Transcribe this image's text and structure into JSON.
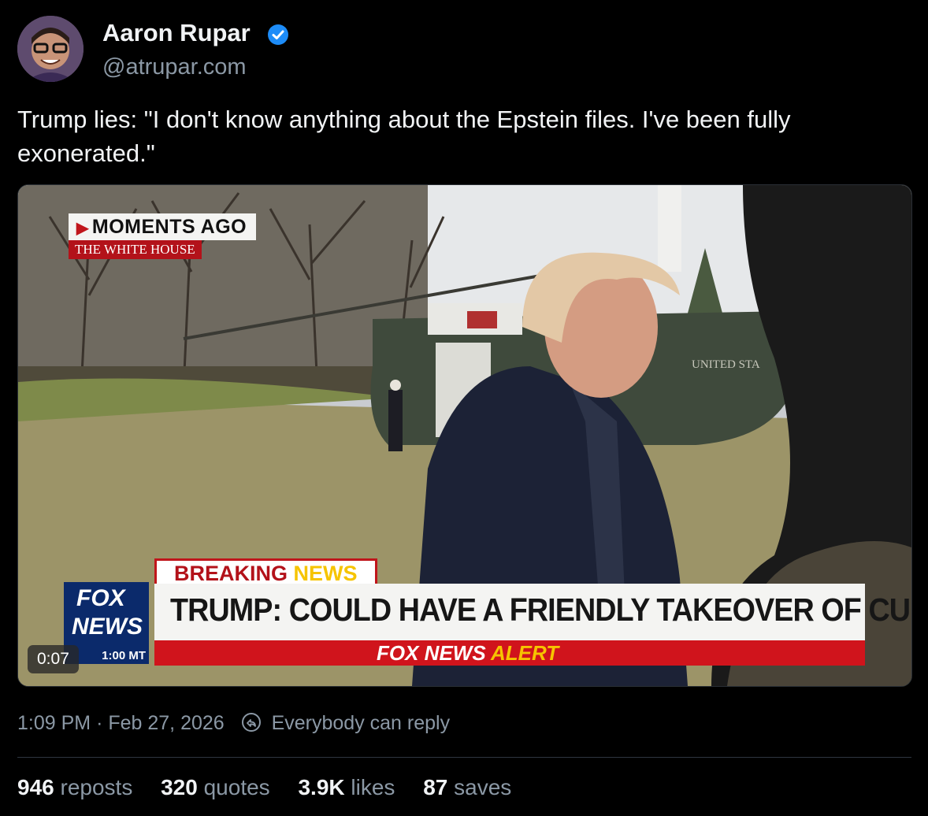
{
  "author": {
    "name": "Aaron Rupar",
    "handle": "@atrupar.com",
    "verified": true,
    "verified_color": "#1d8cf8"
  },
  "post": {
    "text": "Trump lies: \"I don't know anything about the Epstein files. I've been fully exonerated.\""
  },
  "media": {
    "moments_label": "MOMENTS AGO",
    "location_label": "THE WHITE HOUSE",
    "breaking_word": "BREAKING",
    "news_word": "NEWS",
    "headline": "TRUMP: COULD HAVE A FRIENDLY TAKEOVER OF CUBA",
    "alert_brand": "FOX NEWS",
    "alert_word": "ALERT",
    "logo_line1": "FOX",
    "logo_line2": "NEWS",
    "logo_time": "1:00 MT",
    "helicopter_text": "UNITED STA",
    "duration": "0:07"
  },
  "meta": {
    "time": "1:09 PM",
    "separator": "·",
    "date": "Feb 27, 2026",
    "reply_setting": "Everybody can reply",
    "reply_icon": "reply-restriction-icon"
  },
  "stats": {
    "reposts_count": "946",
    "reposts_label": "reposts",
    "quotes_count": "320",
    "quotes_label": "quotes",
    "likes_count": "3.9K",
    "likes_label": "likes",
    "saves_count": "87",
    "saves_label": "saves"
  },
  "colors": {
    "background": "#000000",
    "text_primary": "#f1f3f5",
    "text_secondary": "#8b98a5",
    "fox_red": "#d0141c",
    "fox_yellow": "#f6c400",
    "fox_blue": "#0b2a6b"
  }
}
